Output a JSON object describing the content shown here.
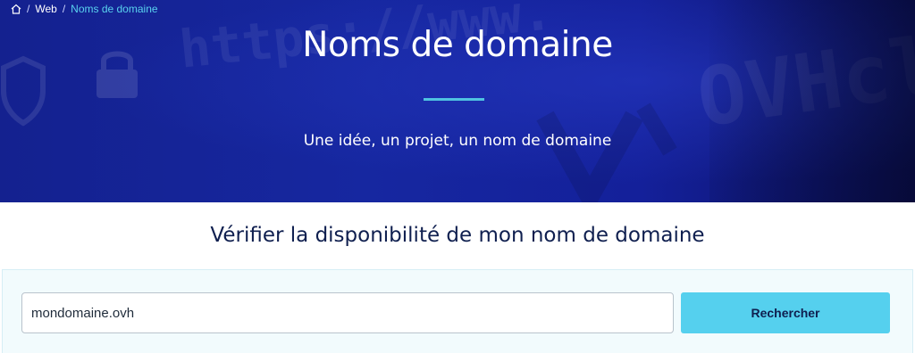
{
  "breadcrumb": {
    "home_icon": "home-icon",
    "items": [
      "Web",
      "Noms de domaine"
    ]
  },
  "hero": {
    "title": "Noms de domaine",
    "subtitle": "Une idée, un projet, un nom de domaine",
    "background_url_text": "https://www.",
    "background_brand_text": "OVHcl"
  },
  "search": {
    "heading": "Vérifier la disponibilité de mon nom de domaine",
    "input_value": "mondomaine.ovh",
    "button_label": "Rechercher"
  },
  "colors": {
    "hero_bg": "#1627a0",
    "accent": "#55d0ee",
    "heading_text": "#0f1f4f"
  }
}
